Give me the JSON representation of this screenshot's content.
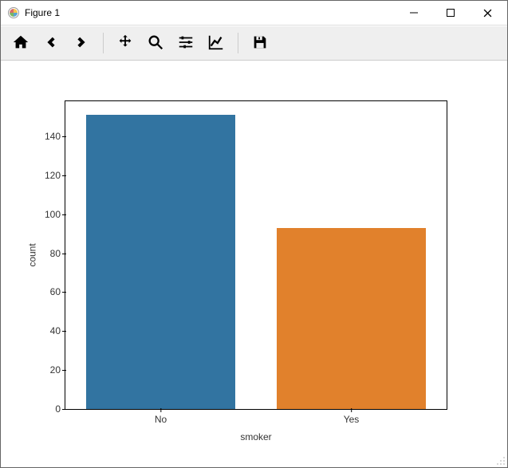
{
  "window": {
    "title": "Figure 1"
  },
  "toolbar": {
    "items": [
      "home",
      "back",
      "forward",
      "|",
      "pan",
      "zoom",
      "configure",
      "edit-axes",
      "|",
      "save"
    ]
  },
  "chart_data": {
    "type": "bar",
    "categories": [
      "No",
      "Yes"
    ],
    "values": [
      151,
      93
    ],
    "xlabel": "smoker",
    "ylabel": "count",
    "yticks": [
      0,
      20,
      40,
      60,
      80,
      100,
      120,
      140
    ],
    "ylim": [
      0,
      158
    ],
    "colors": [
      "#3274a1",
      "#e1812c"
    ]
  }
}
